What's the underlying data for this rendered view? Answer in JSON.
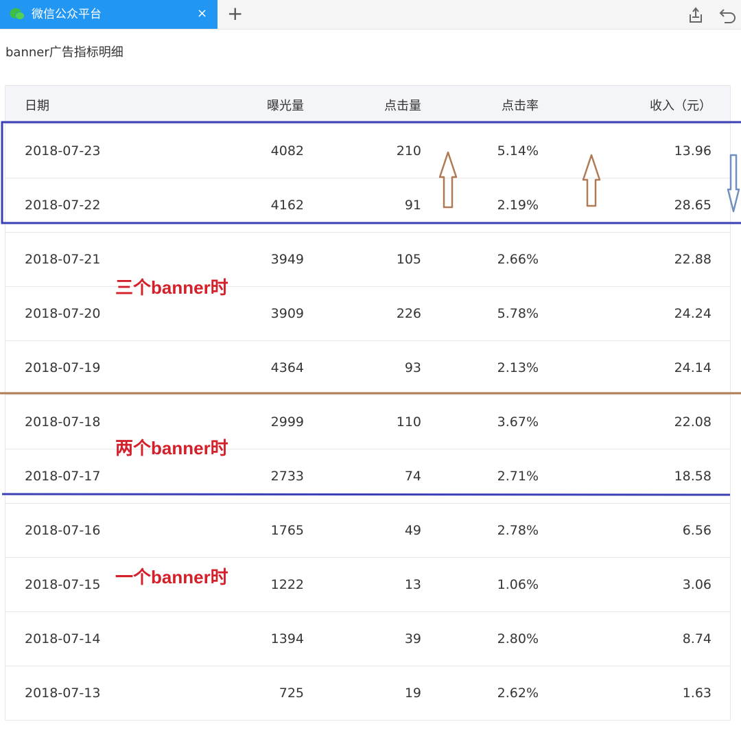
{
  "browser": {
    "tab_title": "微信公众平台",
    "tab_close": "×",
    "new_tab": "+"
  },
  "page": {
    "title": "banner广告指标明细"
  },
  "table": {
    "headers": [
      "日期",
      "曝光量",
      "点击量",
      "点击率",
      "收入（元）"
    ],
    "rows": [
      [
        "2018-07-23",
        "4082",
        "210",
        "5.14%",
        "13.96"
      ],
      [
        "2018-07-22",
        "4162",
        "91",
        "2.19%",
        "28.65"
      ],
      [
        "2018-07-21",
        "3949",
        "105",
        "2.66%",
        "22.88"
      ],
      [
        "2018-07-20",
        "3909",
        "226",
        "5.78%",
        "24.24"
      ],
      [
        "2018-07-19",
        "4364",
        "93",
        "2.13%",
        "24.14"
      ],
      [
        "2018-07-18",
        "2999",
        "110",
        "3.67%",
        "22.08"
      ],
      [
        "2018-07-17",
        "2733",
        "74",
        "2.71%",
        "18.58"
      ],
      [
        "2018-07-16",
        "1765",
        "49",
        "2.78%",
        "6.56"
      ],
      [
        "2018-07-15",
        "1222",
        "13",
        "1.06%",
        "3.06"
      ],
      [
        "2018-07-14",
        "1394",
        "39",
        "2.80%",
        "8.74"
      ],
      [
        "2018-07-13",
        "725",
        "19",
        "2.62%",
        "1.63"
      ]
    ]
  },
  "annotations": {
    "three_banners": "三个banner时",
    "two_banners": "两个banner时",
    "one_banner": "一个banner时",
    "colors": {
      "note_text": "#d4202b",
      "box_blue": "#3b3fb5",
      "divider_brown": "#b07a55",
      "arrow_brown": "#b07a55",
      "arrow_blue": "#6f8fbf"
    },
    "arrows": [
      "up-arrow-clicks",
      "up-arrow-ctr",
      "down-arrow-revenue"
    ]
  }
}
